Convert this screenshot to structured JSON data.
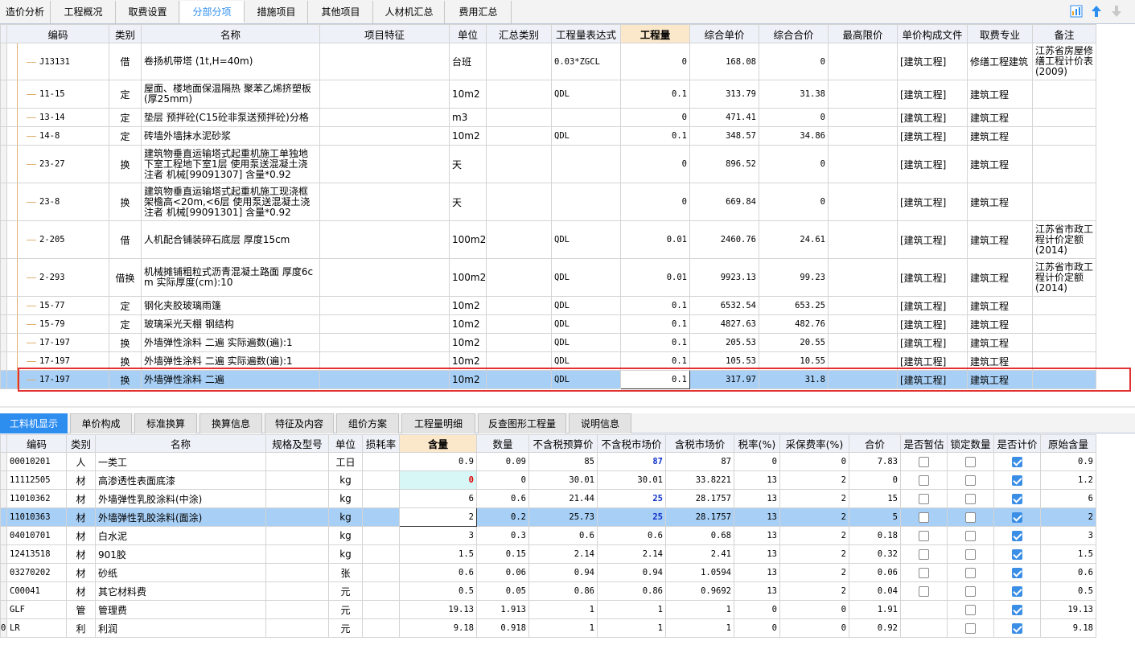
{
  "top_tabs": [
    "造价分析",
    "工程概况",
    "取费设置",
    "分部分项",
    "措施项目",
    "其他项目",
    "人材机汇总",
    "费用汇总"
  ],
  "top_tabs_active": 3,
  "toolbar_icons": [
    "chart-icon",
    "arrow-up-icon",
    "arrow-down-icon"
  ],
  "upper": {
    "headers": [
      "编码",
      "类别",
      "名称",
      "项目特征",
      "单位",
      "汇总类别",
      "工程量表达式",
      "工程量",
      "综合单价",
      "综合合价",
      "最高限价",
      "单价构成文件",
      "取费专业",
      "备注"
    ],
    "rows": [
      {
        "code": "J13131",
        "type": "借",
        "name": "卷扬机带塔 (1t,H=40m)",
        "unit": "台班",
        "expr": "0.03*ZGCL",
        "qty": "0",
        "unit_price": "168.08",
        "total": "0",
        "file": "[建筑工程]",
        "major": "修缮工程建筑",
        "note": "江苏省房屋修缮工程计价表(2009)"
      },
      {
        "code": "11-15",
        "type": "定",
        "name": "屋面、楼地面保温隔热 聚苯乙烯挤塑板(厚25mm)",
        "unit": "10m2",
        "expr": "QDL",
        "qty": "0.1",
        "unit_price": "313.79",
        "total": "31.38",
        "file": "[建筑工程]",
        "major": "建筑工程",
        "note": ""
      },
      {
        "code": "13-14",
        "type": "定",
        "name": "垫层 预拌砼(C15砼非泵送预拌砼)分格",
        "unit": "m3",
        "expr": "",
        "qty": "0",
        "unit_price": "471.41",
        "total": "0",
        "file": "[建筑工程]",
        "major": "建筑工程",
        "note": ""
      },
      {
        "code": "14-8",
        "type": "定",
        "name": "砖墙外墙抹水泥砂浆",
        "unit": "10m2",
        "expr": "QDL",
        "qty": "0.1",
        "unit_price": "348.57",
        "total": "34.86",
        "file": "[建筑工程]",
        "major": "建筑工程",
        "note": ""
      },
      {
        "code": "23-27",
        "type": "换",
        "name": "建筑物垂直运输塔式起重机施工单独地下室工程地下室1层  使用泵送混凝土浇注者 机械[99091307] 含量*0.92",
        "unit": "天",
        "expr": "",
        "qty": "0",
        "unit_price": "896.52",
        "total": "0",
        "file": "[建筑工程]",
        "major": "建筑工程",
        "note": ""
      },
      {
        "code": "23-8",
        "type": "换",
        "name": "建筑物垂直运输塔式起重机施工现浇框架檐高<20m,<6层  使用泵送混凝土浇注者 机械[99091301] 含量*0.92",
        "unit": "天",
        "expr": "",
        "qty": "0",
        "unit_price": "669.84",
        "total": "0",
        "file": "[建筑工程]",
        "major": "建筑工程",
        "note": ""
      },
      {
        "code": "2-205",
        "type": "借",
        "name": "人机配合铺装碎石底层 厚度15cm",
        "unit": "100m2",
        "expr": "QDL",
        "qty": "0.01",
        "unit_price": "2460.76",
        "total": "24.61",
        "file": "[建筑工程]",
        "major": "建筑工程",
        "note": "江苏省市政工程计价定额(2014)"
      },
      {
        "code": "2-293",
        "type": "借换",
        "name": "机械摊铺粗粒式沥青混凝土路面 厚度6cm  实际厚度(cm):10",
        "unit": "100m2",
        "expr": "QDL",
        "qty": "0.01",
        "unit_price": "9923.13",
        "total": "99.23",
        "file": "[建筑工程]",
        "major": "建筑工程",
        "note": "江苏省市政工程计价定额(2014)"
      },
      {
        "code": "15-77",
        "type": "定",
        "name": "钢化夹胶玻璃雨篷",
        "unit": "10m2",
        "expr": "QDL",
        "qty": "0.1",
        "unit_price": "6532.54",
        "total": "653.25",
        "file": "[建筑工程]",
        "major": "建筑工程",
        "note": ""
      },
      {
        "code": "15-79",
        "type": "定",
        "name": "玻璃采光天棚 钢结构",
        "unit": "10m2",
        "expr": "QDL",
        "qty": "0.1",
        "unit_price": "4827.63",
        "total": "482.76",
        "file": "[建筑工程]",
        "major": "建筑工程",
        "note": ""
      },
      {
        "code": "17-197",
        "type": "换",
        "name": "外墙弹性涂料 二遍  实际遍数(遍):1",
        "unit": "10m2",
        "expr": "QDL",
        "qty": "0.1",
        "unit_price": "205.53",
        "total": "20.55",
        "file": "[建筑工程]",
        "major": "建筑工程",
        "note": ""
      },
      {
        "code": "17-197",
        "type": "换",
        "name": "外墙弹性涂料 二遍  实际遍数(遍):1",
        "unit": "10m2",
        "expr": "QDL",
        "qty": "0.1",
        "unit_price": "105.53",
        "total": "10.55",
        "file": "[建筑工程]",
        "major": "建筑工程",
        "note": ""
      },
      {
        "code": "17-197",
        "type": "换",
        "name": "外墙弹性涂料 二遍",
        "unit": "10m2",
        "expr": "QDL",
        "qty": "0.1",
        "unit_price": "317.97",
        "total": "31.8",
        "file": "[建筑工程]",
        "major": "建筑工程",
        "note": ""
      }
    ]
  },
  "bottom_tabs": [
    "工料机显示",
    "单价构成",
    "标准换算",
    "换算信息",
    "特征及内容",
    "组价方案",
    "工程量明细",
    "反查图形工程量",
    "说明信息"
  ],
  "bottom_tabs_active": 0,
  "lower": {
    "headers": [
      "编码",
      "类别",
      "名称",
      "规格及型号",
      "单位",
      "损耗率",
      "含量",
      "数量",
      "不含税预算价",
      "不含税市场价",
      "含税市场价",
      "税率(%)",
      "采保费率(%)",
      "合价",
      "是否暂估",
      "锁定数量",
      "是否计价",
      "原始含量"
    ],
    "rows": [
      {
        "row_no": "",
        "code": "00010201",
        "type": "人",
        "name": "一类工",
        "unit": "工日",
        "content": "0.9",
        "qty": "0.09",
        "budget": "85",
        "market": "87",
        "tax_market": "87",
        "tax": "0",
        "fee": "0",
        "total": "7.83",
        "prov": false,
        "lock": false,
        "priced": true,
        "orig": "0.9"
      },
      {
        "row_no": "",
        "code": "11112505",
        "type": "材",
        "name": "高渗透性表面底漆",
        "unit": "kg",
        "content": "0",
        "qty": "0",
        "budget": "30.01",
        "market": "30.01",
        "tax_market": "33.8221",
        "tax": "13",
        "fee": "2",
        "total": "0",
        "prov": false,
        "lock": false,
        "priced": true,
        "orig": "1.2"
      },
      {
        "row_no": "",
        "code": "11010362",
        "type": "材",
        "name": "外墙弹性乳胶涂料(中涂)",
        "unit": "kg",
        "content": "6",
        "qty": "0.6",
        "budget": "21.44",
        "market": "25",
        "tax_market": "28.1757",
        "tax": "13",
        "fee": "2",
        "total": "15",
        "prov": false,
        "lock": false,
        "priced": true,
        "orig": "6"
      },
      {
        "row_no": "",
        "code": "11010363",
        "type": "材",
        "name": "外墙弹性乳胶涂料(面涂)",
        "unit": "kg",
        "content": "2",
        "qty": "0.2",
        "budget": "25.73",
        "market": "25",
        "tax_market": "28.1757",
        "tax": "13",
        "fee": "2",
        "total": "5",
        "prov": false,
        "lock": false,
        "priced": true,
        "orig": "2"
      },
      {
        "row_no": "",
        "code": "04010701",
        "type": "材",
        "name": "白水泥",
        "unit": "kg",
        "content": "3",
        "qty": "0.3",
        "budget": "0.6",
        "market": "0.6",
        "tax_market": "0.68",
        "tax": "13",
        "fee": "2",
        "total": "0.18",
        "prov": false,
        "lock": false,
        "priced": true,
        "orig": "3"
      },
      {
        "row_no": "",
        "code": "12413518",
        "type": "材",
        "name": "901胶",
        "unit": "kg",
        "content": "1.5",
        "qty": "0.15",
        "budget": "2.14",
        "market": "2.14",
        "tax_market": "2.41",
        "tax": "13",
        "fee": "2",
        "total": "0.32",
        "prov": false,
        "lock": false,
        "priced": true,
        "orig": "1.5"
      },
      {
        "row_no": "",
        "code": "03270202",
        "type": "材",
        "name": "砂纸",
        "unit": "张",
        "content": "0.6",
        "qty": "0.06",
        "budget": "0.94",
        "market": "0.94",
        "tax_market": "1.0594",
        "tax": "13",
        "fee": "2",
        "total": "0.06",
        "prov": false,
        "lock": false,
        "priced": true,
        "orig": "0.6"
      },
      {
        "row_no": "",
        "code": "C00041",
        "type": "材",
        "name": "其它材料费",
        "unit": "元",
        "content": "0.5",
        "qty": "0.05",
        "budget": "0.86",
        "market": "0.86",
        "tax_market": "0.9692",
        "tax": "13",
        "fee": "2",
        "total": "0.04",
        "prov": false,
        "lock": false,
        "priced": true,
        "orig": "0.5"
      },
      {
        "row_no": "",
        "code": "GLF",
        "type": "管",
        "name": "管理费",
        "unit": "元",
        "content": "19.13",
        "qty": "1.913",
        "budget": "1",
        "market": "1",
        "tax_market": "1",
        "tax": "0",
        "fee": "0",
        "total": "1.91",
        "prov": null,
        "lock": false,
        "priced": true,
        "orig": "19.13"
      },
      {
        "row_no": "0",
        "code": "LR",
        "type": "利",
        "name": "利润",
        "unit": "元",
        "content": "9.18",
        "qty": "0.918",
        "budget": "1",
        "market": "1",
        "tax_market": "1",
        "tax": "0",
        "fee": "0",
        "total": "0.92",
        "prov": null,
        "lock": false,
        "priced": true,
        "orig": "9.18"
      }
    ]
  },
  "colors": {
    "accent": "#2e8ef0",
    "selection": "#a8cff5",
    "highlight_frame": "#e23131"
  }
}
